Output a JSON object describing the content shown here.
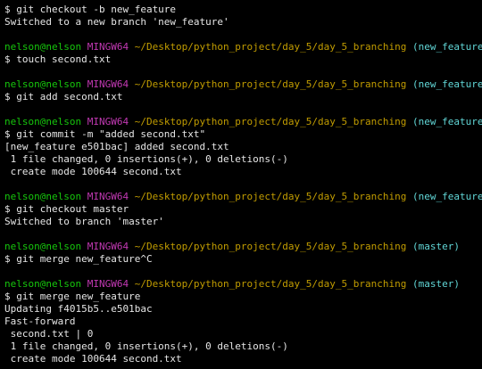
{
  "colors": {
    "background": "#000000",
    "text": "#e6e6e6",
    "user": "#16c60c",
    "host": "#c239b3",
    "path": "#c19c00",
    "branch": "#61d6d6"
  },
  "lines": [
    {
      "type": "cmd",
      "text": "$ git checkout -b new_feature"
    },
    {
      "type": "out",
      "text": "Switched to a new branch 'new_feature'"
    },
    {
      "type": "blank"
    },
    {
      "type": "prompt",
      "user": "nelson@nelson",
      "host": "MINGW64",
      "path": "~/Desktop/python_project/day_5/day_5_branching",
      "branch": "(new_feature)"
    },
    {
      "type": "cmd",
      "text": "$ touch second.txt"
    },
    {
      "type": "blank"
    },
    {
      "type": "prompt",
      "user": "nelson@nelson",
      "host": "MINGW64",
      "path": "~/Desktop/python_project/day_5/day_5_branching",
      "branch": "(new_feature)"
    },
    {
      "type": "cmd",
      "text": "$ git add second.txt"
    },
    {
      "type": "blank"
    },
    {
      "type": "prompt",
      "user": "nelson@nelson",
      "host": "MINGW64",
      "path": "~/Desktop/python_project/day_5/day_5_branching",
      "branch": "(new_feature)"
    },
    {
      "type": "cmd",
      "text": "$ git commit -m \"added second.txt\""
    },
    {
      "type": "out",
      "text": "[new_feature e501bac] added second.txt"
    },
    {
      "type": "out",
      "text": " 1 file changed, 0 insertions(+), 0 deletions(-)"
    },
    {
      "type": "out",
      "text": " create mode 100644 second.txt"
    },
    {
      "type": "blank"
    },
    {
      "type": "prompt",
      "user": "nelson@nelson",
      "host": "MINGW64",
      "path": "~/Desktop/python_project/day_5/day_5_branching",
      "branch": "(new_feature)"
    },
    {
      "type": "cmd",
      "text": "$ git checkout master"
    },
    {
      "type": "out",
      "text": "Switched to branch 'master'"
    },
    {
      "type": "blank"
    },
    {
      "type": "prompt",
      "user": "nelson@nelson",
      "host": "MINGW64",
      "path": "~/Desktop/python_project/day_5/day_5_branching",
      "branch": "(master)"
    },
    {
      "type": "cmd",
      "text": "$ git merge new_feature^C"
    },
    {
      "type": "blank"
    },
    {
      "type": "prompt",
      "user": "nelson@nelson",
      "host": "MINGW64",
      "path": "~/Desktop/python_project/day_5/day_5_branching",
      "branch": "(master)"
    },
    {
      "type": "cmd",
      "text": "$ git merge new_feature"
    },
    {
      "type": "out",
      "text": "Updating f4015b5..e501bac"
    },
    {
      "type": "out",
      "text": "Fast-forward"
    },
    {
      "type": "out",
      "text": " second.txt | 0"
    },
    {
      "type": "out",
      "text": " 1 file changed, 0 insertions(+), 0 deletions(-)"
    },
    {
      "type": "out",
      "text": " create mode 100644 second.txt"
    }
  ]
}
